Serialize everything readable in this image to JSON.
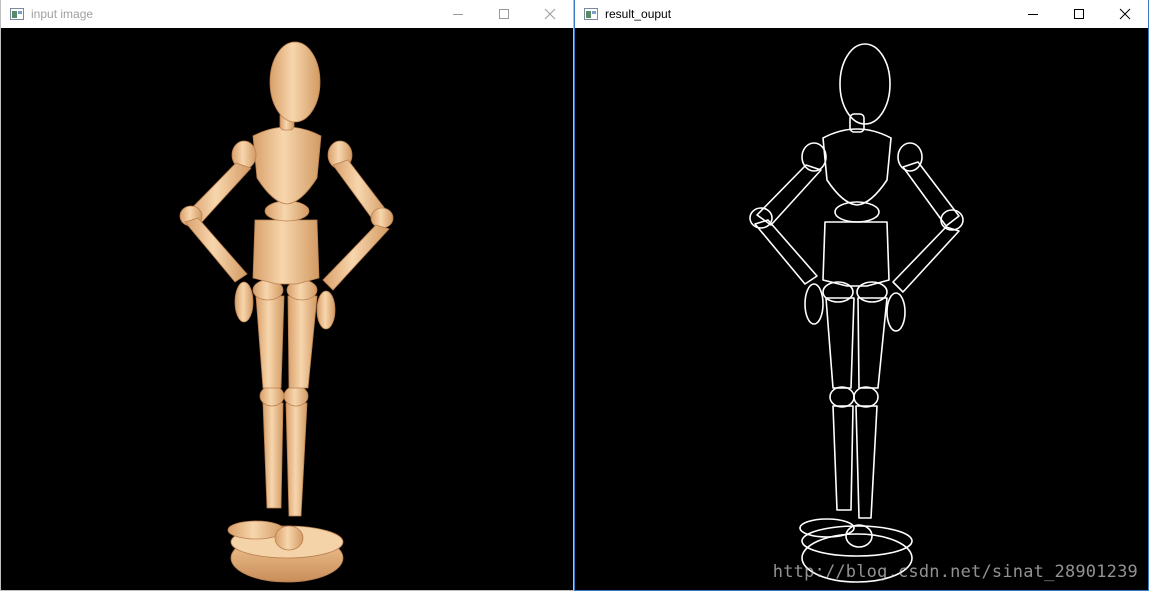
{
  "windows": [
    {
      "title": "input image",
      "controls": [
        "minimize-icon",
        "maximize-icon",
        "close-icon"
      ],
      "image": "wooden artist mannequin figure on round base, black background"
    },
    {
      "title": "result_ouput",
      "controls": [
        "minimize-icon",
        "maximize-icon",
        "close-icon"
      ],
      "image": "white edge-detection outline of the mannequin on black"
    }
  ],
  "watermark": "http://blog.csdn.net/sinat_28901239",
  "colors": {
    "wood_light": "#f4cfa2",
    "wood_mid": "#e9b680",
    "wood_dark": "#c98e5a",
    "edge": "#ffffff",
    "canvas_bg": "#000000",
    "active_border": "#3a78c8"
  }
}
